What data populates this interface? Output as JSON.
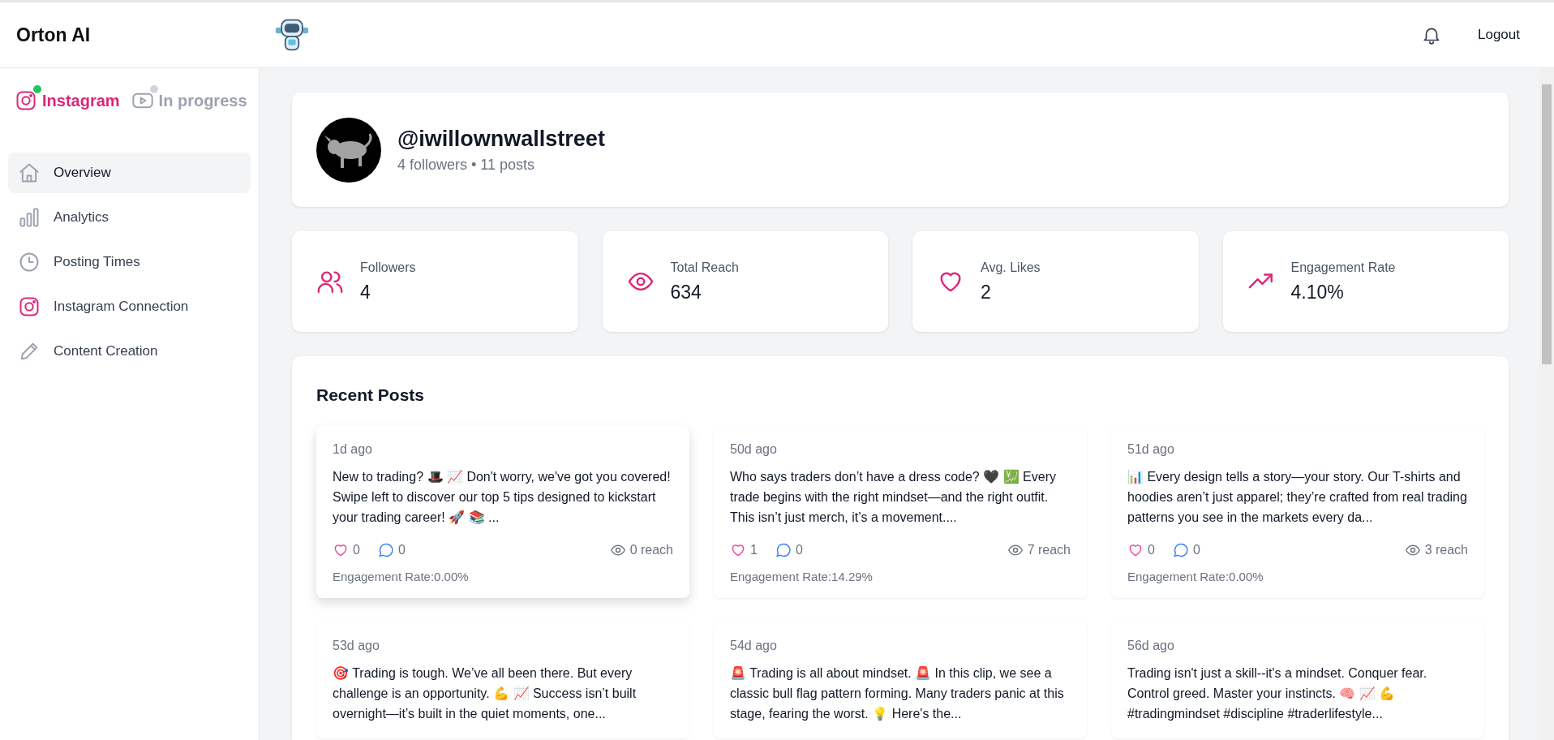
{
  "header": {
    "brand": "Orton AI",
    "logout": "Logout"
  },
  "sidebar": {
    "platforms": [
      {
        "label": "Instagram",
        "kind": "instagram",
        "selected": true,
        "color": "#22c55e"
      },
      {
        "label": "In progress",
        "kind": "video",
        "selected": false,
        "color": "#d1d5db"
      }
    ],
    "items": [
      {
        "label": "Overview",
        "kind": "home",
        "selected": true
      },
      {
        "label": "Analytics",
        "kind": "bars",
        "selected": false
      },
      {
        "label": "Posting Times",
        "kind": "clock",
        "selected": false
      },
      {
        "label": "Instagram Connection",
        "kind": "instagram",
        "selected": false
      },
      {
        "label": "Content Creation",
        "kind": "pencil",
        "selected": false
      }
    ]
  },
  "profile": {
    "handle": "@iwillownwallstreet",
    "summary": "4 followers • 11 posts"
  },
  "stats": [
    {
      "label": "Followers",
      "value": "4",
      "kind": "users"
    },
    {
      "label": "Total Reach",
      "value": "634",
      "kind": "eye"
    },
    {
      "label": "Avg. Likes",
      "value": "2",
      "kind": "heart"
    },
    {
      "label": "Engagement Rate",
      "value": "4.10%",
      "kind": "trend"
    }
  ],
  "recent_posts": {
    "title": "Recent Posts",
    "posts": [
      {
        "age": "1d ago",
        "text": "New to trading? 🎩 📈 Don't worry, we've got you covered! Swipe left to discover our top 5 tips designed to kickstart your trading career! 🚀 📚 ...",
        "likes": "0",
        "comments": "0",
        "reach": "0 reach",
        "engagement": "Engagement Rate:0.00%",
        "hovered": true
      },
      {
        "age": "50d ago",
        "text": "Who says traders don’t have a dress code? 🖤 💹 Every trade begins with the right mindset—and the right outfit. This isn’t just merch, it’s a movement....",
        "likes": "1",
        "comments": "0",
        "reach": "7 reach",
        "engagement": "Engagement Rate:14.29%",
        "hovered": false
      },
      {
        "age": "51d ago",
        "text": "📊 Every design tells a story—your story. Our T-shirts and hoodies aren’t just apparel; they’re crafted from real trading patterns you see in the markets every da...",
        "likes": "0",
        "comments": "0",
        "reach": "3 reach",
        "engagement": "Engagement Rate:0.00%",
        "hovered": false
      },
      {
        "age": "53d ago",
        "text": "🎯 Trading is tough. We’ve all been there. But every challenge is an opportunity. 💪 📈 Success isn’t built overnight—it’s built in the quiet moments, one...",
        "hovered": false
      },
      {
        "age": "54d ago",
        "text": "🚨 Trading is all about mindset. 🚨 In this clip, we see a classic bull flag pattern forming. Many traders panic at this stage, fearing the worst. 💡 Here's the...",
        "hovered": false
      },
      {
        "age": "56d ago",
        "text": "Trading isn't just a skill--it's a mindset. Conquer fear. Control greed. Master your instincts. 🧠 📈 💪 #tradingmindset #discipline #traderlifestyle...",
        "hovered": false
      }
    ]
  }
}
